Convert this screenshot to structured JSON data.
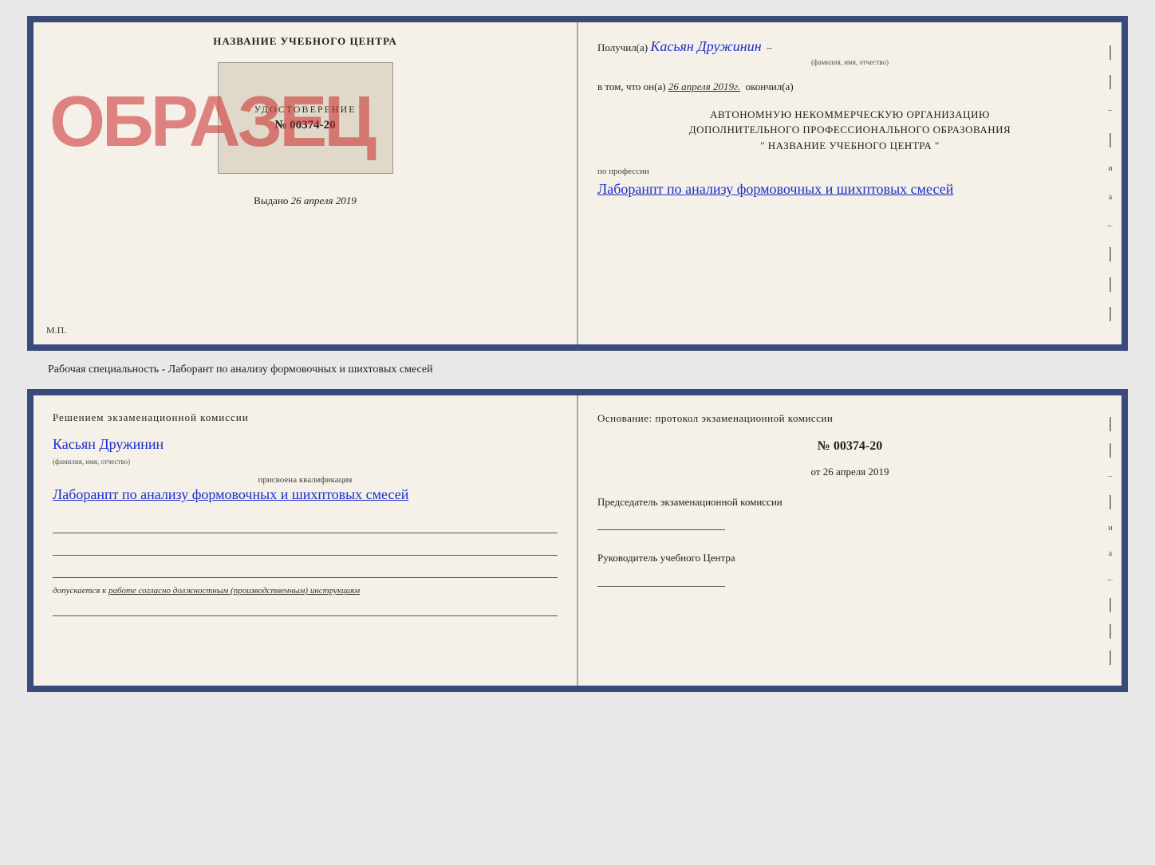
{
  "top_doc": {
    "left": {
      "training_center": "НАЗВАНИЕ УЧЕБНОГО ЦЕНТРА",
      "certificate_label": "УДОСТОВЕРЕНИЕ",
      "certificate_number": "№ 00374-20",
      "stamp_text": "ОБРАЗЕЦ",
      "issued_label": "Выдано",
      "issued_date": "26 апреля 2019",
      "mp_label": "М.П."
    },
    "right": {
      "received_prefix": "Получил(а)",
      "received_name": "Касьян Дружинин",
      "fio_hint": "(фамилия, имя, отчество)",
      "date_prefix": "в том, что он(а)",
      "date_value": "26 апреля 2019г.",
      "date_suffix": "окончил(а)",
      "org_line1": "АВТОНОМНУЮ НЕКОММЕРЧЕСКУЮ ОРГАНИЗАЦИЮ",
      "org_line2": "ДОПОЛНИТЕЛЬНОГО ПРОФЕССИОНАЛЬНОГО ОБРАЗОВАНИЯ",
      "org_name": "\" НАЗВАНИЕ УЧЕБНОГО ЦЕНТРА \"",
      "profession_prefix": "по профессии",
      "profession_value": "Лаборанпт по анализу формовочных и шихптовых смесей"
    }
  },
  "specialty_label": "Рабочая специальность - Лаборант по анализу формовочных и шихтовых смесей",
  "bottom_doc": {
    "left": {
      "decision_text": "Решением экзаменационной комиссии",
      "person_name": "Касьян Дружинин",
      "fio_hint": "(фамилия, имя, отчество)",
      "qualification_prefix": "присвоена квалификация",
      "qualification_value": "Лаборанпт по анализу формовочных и шихптовых смесей",
      "допускается_text": "допускается к",
      "допускается_value": "работе согласно должностным (производственным) инструкциям"
    },
    "right": {
      "osnov_text": "Основание: протокол экзаменационной комиссии",
      "protocol_number": "№ 00374-20",
      "date_prefix": "от",
      "date_value": "26 апреля 2019",
      "chairman_label": "Председатель экзаменационной комиссии",
      "director_label": "Руководитель учебного Центра"
    }
  }
}
